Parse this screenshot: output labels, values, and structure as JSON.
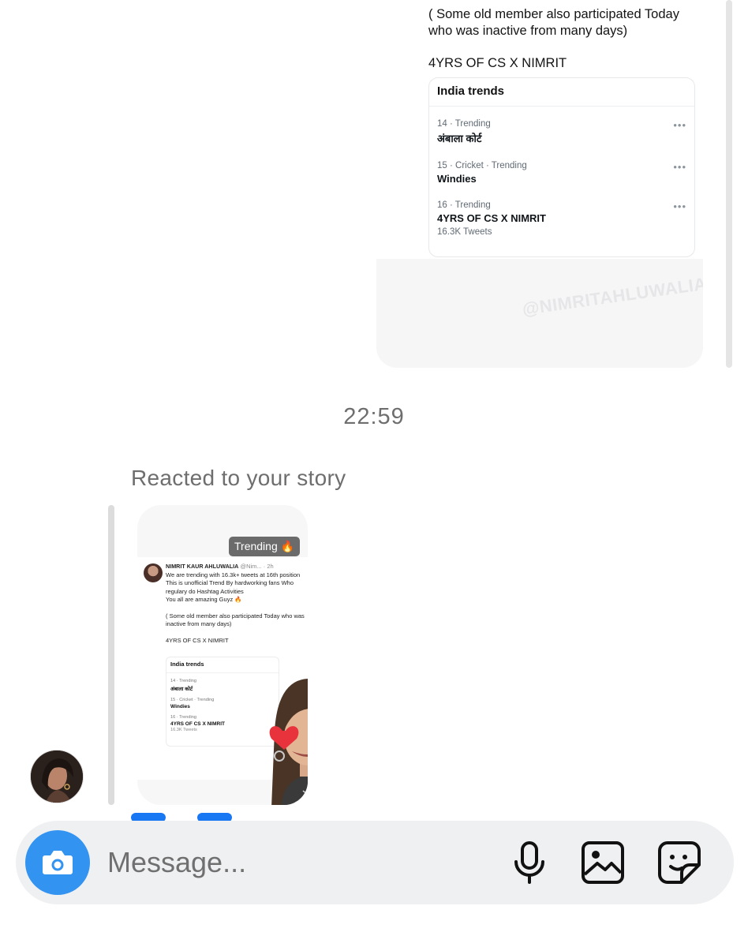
{
  "shared_post": {
    "caption_lines": [
      "( Some old member also participated Today who was inactive from many days)",
      "4YRS OF CS X NIMRIT"
    ],
    "trends_card": {
      "title": "India trends",
      "items": [
        {
          "meta": "14 · Trending",
          "name": "अंबाला कोर्ट",
          "count": ""
        },
        {
          "meta": "15 · Cricket · Trending",
          "name": "Windies",
          "count": ""
        },
        {
          "meta": "16 · Trending",
          "name": "4YRS OF CS X NIMRIT",
          "count": "16.3K Tweets"
        }
      ]
    },
    "watermark": "@NIMRITAHLUWALIA"
  },
  "timestamp": "22:59",
  "reaction": {
    "label": "Reacted to your story",
    "story": {
      "sticker": "Trending 🔥",
      "author": "NIMRIT KAUR AHLUWALIA",
      "handle": "@Nim... · 2h",
      "paragraphs": [
        "We are trending with 16.3k+ tweets at 16th position\nThis is unofficial Trend By hardworking fans Who regulary do Hashtag Activities\nYou all are amazing Guyz 🔥",
        "( Some old member also participated Today who was inactive from many days)",
        "4YRS OF CS X NIMRIT"
      ],
      "card_title": "India trends",
      "trends": [
        {
          "meta": "14 · Trending",
          "name": "अंबाला कोर्ट",
          "count": ""
        },
        {
          "meta": "15 · Cricket · Trending",
          "name": "Windies",
          "count": ""
        },
        {
          "meta": "16 · Trending",
          "name": "4YRS OF CS X NIMRIT",
          "count": "16.3K Tweets"
        }
      ],
      "reaction_icon": "heart-eyes-bitmoji"
    }
  },
  "composer": {
    "placeholder": "Message...",
    "icons": [
      "camera-icon",
      "microphone-icon",
      "gallery-icon",
      "sticker-icon"
    ]
  },
  "colors": {
    "accent": "#3293f0",
    "composer_bg": "#eff0f2",
    "muted_text": "#6e6e6e"
  }
}
